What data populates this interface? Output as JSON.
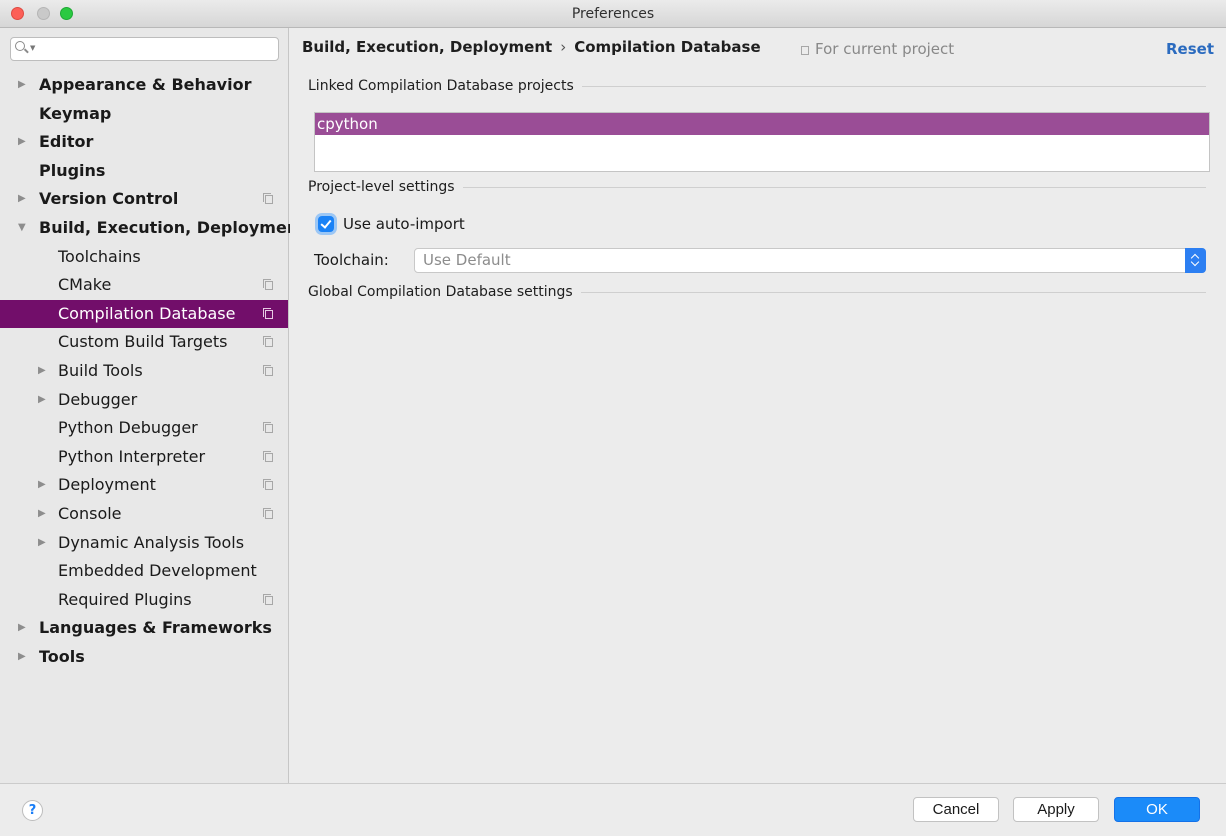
{
  "window": {
    "title": "Preferences"
  },
  "search": {
    "placeholder": ""
  },
  "sidebar": {
    "items": [
      {
        "label": "Appearance & Behavior",
        "level": 0,
        "bold": true,
        "arrow": "▶",
        "project_icon": false,
        "selected": false
      },
      {
        "label": "Keymap",
        "level": 0,
        "bold": true,
        "arrow": "",
        "project_icon": false,
        "selected": false
      },
      {
        "label": "Editor",
        "level": 0,
        "bold": true,
        "arrow": "▶",
        "project_icon": false,
        "selected": false
      },
      {
        "label": "Plugins",
        "level": 0,
        "bold": true,
        "arrow": "",
        "project_icon": false,
        "selected": false
      },
      {
        "label": "Version Control",
        "level": 0,
        "bold": true,
        "arrow": "▶",
        "project_icon": true,
        "selected": false
      },
      {
        "label": "Build, Execution, Deployment",
        "level": 0,
        "bold": true,
        "arrow": "▼",
        "project_icon": false,
        "selected": false
      },
      {
        "label": "Toolchains",
        "level": 1,
        "bold": false,
        "arrow": "",
        "project_icon": false,
        "selected": false
      },
      {
        "label": "CMake",
        "level": 1,
        "bold": false,
        "arrow": "",
        "project_icon": true,
        "selected": false
      },
      {
        "label": "Compilation Database",
        "level": 1,
        "bold": false,
        "arrow": "",
        "project_icon": true,
        "selected": true
      },
      {
        "label": "Custom Build Targets",
        "level": 1,
        "bold": false,
        "arrow": "",
        "project_icon": true,
        "selected": false
      },
      {
        "label": "Build Tools",
        "level": 1,
        "bold": false,
        "arrow": "▶",
        "project_icon": true,
        "selected": false
      },
      {
        "label": "Debugger",
        "level": 1,
        "bold": false,
        "arrow": "▶",
        "project_icon": false,
        "selected": false
      },
      {
        "label": "Python Debugger",
        "level": 1,
        "bold": false,
        "arrow": "",
        "project_icon": true,
        "selected": false
      },
      {
        "label": "Python Interpreter",
        "level": 1,
        "bold": false,
        "arrow": "",
        "project_icon": true,
        "selected": false
      },
      {
        "label": "Deployment",
        "level": 1,
        "bold": false,
        "arrow": "▶",
        "project_icon": true,
        "selected": false
      },
      {
        "label": "Console",
        "level": 1,
        "bold": false,
        "arrow": "▶",
        "project_icon": true,
        "selected": false
      },
      {
        "label": "Dynamic Analysis Tools",
        "level": 1,
        "bold": false,
        "arrow": "▶",
        "project_icon": false,
        "selected": false
      },
      {
        "label": "Embedded Development",
        "level": 1,
        "bold": false,
        "arrow": "",
        "project_icon": false,
        "selected": false
      },
      {
        "label": "Required Plugins",
        "level": 1,
        "bold": false,
        "arrow": "",
        "project_icon": true,
        "selected": false
      },
      {
        "label": "Languages & Frameworks",
        "level": 0,
        "bold": true,
        "arrow": "▶",
        "project_icon": false,
        "selected": false
      },
      {
        "label": "Tools",
        "level": 0,
        "bold": true,
        "arrow": "▶",
        "project_icon": false,
        "selected": false
      }
    ]
  },
  "header": {
    "breadcrumb_parent": "Build, Execution, Deployment",
    "breadcrumb_separator": "›",
    "breadcrumb_current": "Compilation Database",
    "scope": "For current project",
    "reset": "Reset"
  },
  "sections": {
    "linked_projects": "Linked Compilation Database projects",
    "project_level": "Project-level settings",
    "global": "Global Compilation Database settings"
  },
  "linked_projects": {
    "items": [
      "cpython"
    ],
    "selected_index": 0
  },
  "project_settings": {
    "auto_import_label": "Use auto-import",
    "auto_import_checked": true,
    "toolchain_label": "Toolchain:",
    "toolchain_value": "Use Default"
  },
  "footer": {
    "help": "?",
    "cancel": "Cancel",
    "apply": "Apply",
    "ok": "OK"
  },
  "colors": {
    "selection_sidebar": "#720e6a",
    "selection_list": "#9a4d96",
    "accent_blue": "#1b8bf9",
    "link": "#2b6bbf"
  }
}
